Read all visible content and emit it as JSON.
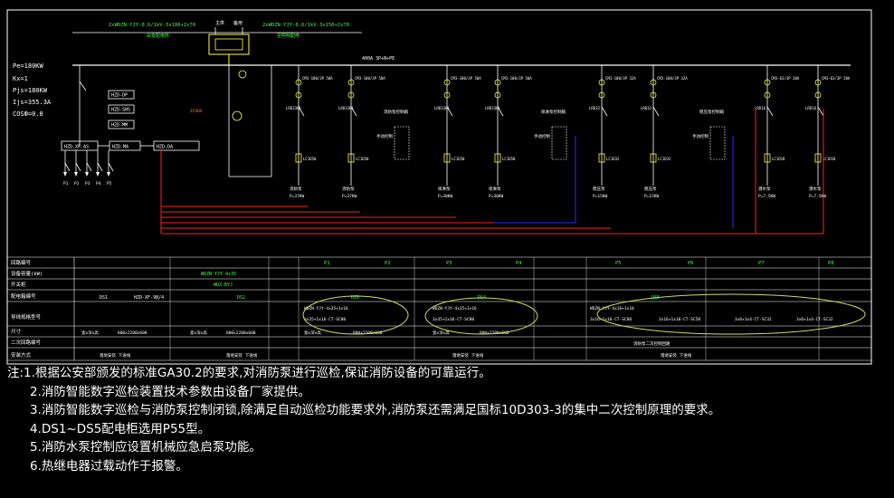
{
  "header": {
    "left_cable": "2xWDZN-YJY-0.6/1kV-3x180+2x70",
    "left_cable_sub": "由变配电所",
    "right_cable": "2xWDZN-YJY-0.6/1kV-3x150+2x70",
    "right_cable_sub": "至照明配电",
    "transfer_label_1": "主供",
    "transfer_label_2": "备用",
    "busbar_label": "400A  3P+N+PE"
  },
  "load_info": {
    "pe": "Pe=180KW",
    "kx": "Kx=1",
    "pjs": "Pjs=180KW",
    "ijs": "Ijs=355.3A",
    "cos": "COSФ=0.8"
  },
  "monitor_boxes": [
    "HZD-DP",
    "HZD-SHS",
    "HZD-MM",
    "HZD-XF-AS",
    "HZD-MA",
    "HZD-DA"
  ],
  "motor_labels": [
    "P1",
    "P2",
    "P3",
    "P4",
    "P5"
  ],
  "feeders": [
    {
      "breaker": "CM3-100/3P 50A",
      "contact": "LC1D50",
      "relay": "LRD3361",
      "load": "消防泵",
      "kw": "P=37KW"
    },
    {
      "breaker": "CM3-100/3P 50A",
      "contact": "LC1D50",
      "relay": "LRD3361",
      "load": "消防泵",
      "kw": "P=37KW"
    },
    {
      "breaker": "CM3-100/3P 50A",
      "contact": "LC1D50",
      "relay": "LRD3361",
      "load": "喷淋泵",
      "kw": "P=30KW"
    },
    {
      "breaker": "CM3-100/3P 50A",
      "contact": "LC1D50",
      "relay": "LRD3361",
      "load": "喷淋泵",
      "kw": "P=30KW"
    },
    {
      "breaker": "CM3-100/3P 32A",
      "contact": "LC1D32",
      "relay": "LRD32",
      "load": "稳压泵",
      "kw": "P=15KW"
    },
    {
      "breaker": "CM3-100/3P 32A",
      "contact": "LC1D32",
      "relay": "LRD32",
      "load": "稳压泵",
      "kw": "P=15KW"
    },
    {
      "breaker": "CM3-63/3P 20A",
      "contact": "LC1D18",
      "relay": "LRD16",
      "load": "潜水泵",
      "kw": "P=7.5KW"
    },
    {
      "breaker": "CM3-63/3P 20A",
      "contact": "LC1D18",
      "relay": "LRD16",
      "load": "潜水泵",
      "kw": "P=7.5KW"
    }
  ],
  "panels": [
    {
      "title": "消防泵控制箱",
      "sub": "手动控制"
    },
    {
      "title": "喷淋泵控制箱",
      "sub": "手动控制"
    },
    {
      "title": "稳压泵控制箱",
      "sub": "手动控制"
    }
  ],
  "table": {
    "row_labels": [
      "回路编号",
      "设备容量(kW)",
      "开关柜",
      "配电箱编号",
      "导线规格型号",
      "尺寸",
      "二次回路编号",
      "安装方式"
    ],
    "loop_numbers": [
      "P1",
      "P2",
      "P3",
      "P4",
      "P5",
      "P6",
      "P7",
      "P8"
    ],
    "incoming": "WDZN-YJY-4x35",
    "switchgear": "WDZ-BYJ",
    "ds_labels": [
      "DS1",
      "HZD-XF-9B/4",
      "DS2",
      "DS3",
      "DS4",
      "DS5"
    ],
    "cable_specs": [
      "WDZN-YJY-4x35+1x16",
      "3x35+1x16-CT-SC80",
      "WDZN-YJY-4x35+1x16",
      "3x35+1x16-CT-SC80",
      "WDZN-YJY-4x16+1x10",
      "3x16+1x10-CT-SC80",
      "3x16+1x10-CT-SC50",
      "3x6+1x4-CT-SC32",
      "3x6+1x4-CT-SC32"
    ],
    "size_cells": [
      "宽x深x高",
      "800x2200x600",
      "宽x深x高",
      "800x2200x600",
      "宽x深x高",
      "800x2200x600",
      "宽x深x高",
      "800x2200x600"
    ],
    "secondary": "消防泵二次控制回路",
    "install": [
      "落地安装 下进线",
      "落地安装 下进线",
      "落地安装 下进线",
      "落地安装 下进线"
    ]
  },
  "notes": [
    "注:1.根据公安部颁发的标准GA30.2的要求,对消防泵进行巡检,保证消防设备的可靠运行。",
    "2.消防智能数字巡检装置技术参数由设备厂家提供。",
    "3.消防智能数字巡检与消防泵控制闭锁,除满足自动巡检功能要求外,消防泵还需满足国标10D303-3的集中二次控制原理的要求。",
    "4.DS1~DS5配电柜选用P55型。",
    "5.消防水泵控制应设置机械应急启泵功能。",
    "6.热继电器过载动作于报警。"
  ],
  "colors": {
    "background": "#000000",
    "white": "#ffffff",
    "red": "#ff2020",
    "yellow": "#ffff40",
    "green": "#40ff40",
    "blue": "#2030ff",
    "cyan": "#00d0d0",
    "ellipse": "#c8e060"
  }
}
